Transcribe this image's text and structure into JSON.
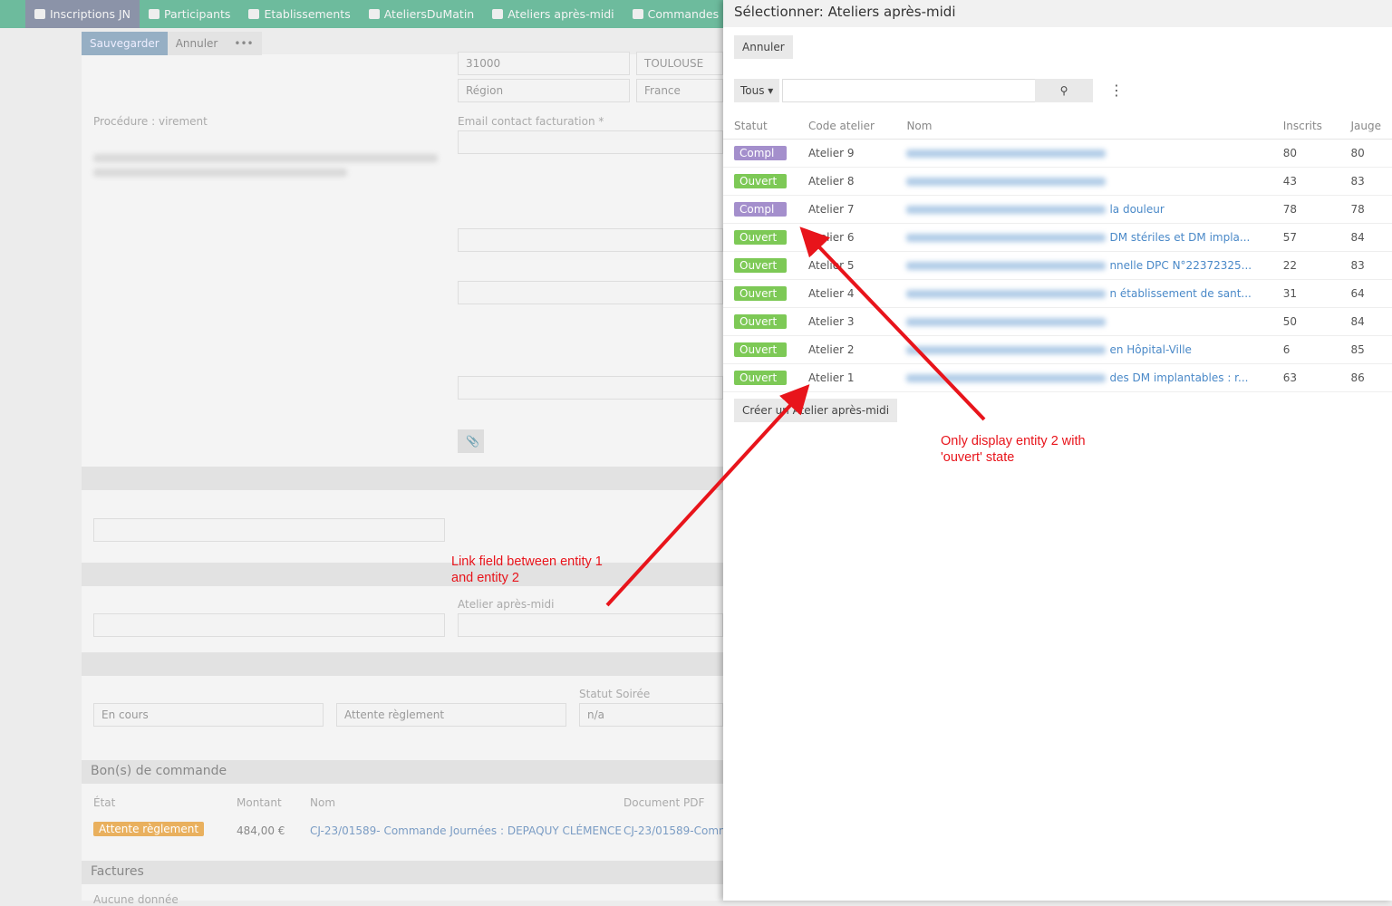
{
  "nav": {
    "tabs": [
      {
        "label": "Inscriptions JN",
        "icon": "id-card-icon",
        "active": true
      },
      {
        "label": "Participants",
        "icon": "user-check-icon"
      },
      {
        "label": "Etablissements",
        "icon": "building-icon"
      },
      {
        "label": "AteliersDuMatin",
        "icon": "presentation-icon"
      },
      {
        "label": "Ateliers après-midi",
        "icon": "presentation-icon"
      },
      {
        "label": "Commandes",
        "icon": "document-icon"
      }
    ]
  },
  "toolbar": {
    "save": "Sauvegarder",
    "cancel": "Annuler",
    "more": "•••"
  },
  "form": {
    "postal_code": "31000",
    "city": "TOULOUSE",
    "region_placeholder": "Région",
    "country": "France",
    "procedure": "Procédure : virement",
    "email_label": "Email contact facturation *",
    "atelier_label": "Atelier après-midi",
    "statut_soiree_label": "Statut Soirée",
    "statut_soiree": "n/a",
    "statut_inscription": "En cours",
    "statut_reglement": "Attente règlement"
  },
  "orders": {
    "title": "Bon(s) de commande",
    "columns": [
      "État",
      "Montant",
      "Nom",
      "Document PDF"
    ],
    "row": {
      "state": "Attente règlement",
      "amount": "484,00 €",
      "name": "CJ-23/01589- Commande Journées : DEPAQUY CLÉMENCE",
      "pdf": "CJ-23/01589-Comm"
    }
  },
  "invoices": {
    "title": "Factures",
    "empty": "Aucune donnée"
  },
  "panel": {
    "title": "Sélectionner: Ateliers après-midi",
    "cancel": "Annuler",
    "filter": "Tous ▾",
    "search_placeholder": "",
    "create": "Créer un Atelier après-midi",
    "columns": [
      "Statut",
      "Code atelier",
      "Nom",
      "Inscrits",
      "Jauge"
    ],
    "rows": [
      {
        "status": "Compl",
        "code": "Atelier 9",
        "nom": "",
        "inscrits": "80",
        "jauge": "80"
      },
      {
        "status": "Ouvert",
        "code": "Atelier 8",
        "nom": "",
        "inscrits": "43",
        "jauge": "83"
      },
      {
        "status": "Compl",
        "code": "Atelier 7",
        "nom": "la douleur",
        "inscrits": "78",
        "jauge": "78"
      },
      {
        "status": "Ouvert",
        "code": "Atelier 6",
        "nom": "DM stériles et DM impla...",
        "inscrits": "57",
        "jauge": "84"
      },
      {
        "status": "Ouvert",
        "code": "Atelier 5",
        "nom": "nnelle DPC N°22372325...",
        "inscrits": "22",
        "jauge": "83"
      },
      {
        "status": "Ouvert",
        "code": "Atelier 4",
        "nom": "n établissement de sant...",
        "inscrits": "31",
        "jauge": "64"
      },
      {
        "status": "Ouvert",
        "code": "Atelier 3",
        "nom": "",
        "inscrits": "50",
        "jauge": "84"
      },
      {
        "status": "Ouvert",
        "code": "Atelier 2",
        "nom": "en Hôpital-Ville",
        "inscrits": "6",
        "jauge": "85"
      },
      {
        "status": "Ouvert",
        "code": "Atelier 1",
        "nom": "des DM implantables : r...",
        "inscrits": "63",
        "jauge": "86"
      }
    ]
  },
  "colors": {
    "compl": "#a48fcc",
    "ouvert": "#7dc956",
    "warning": "#e9b05e",
    "nav": "#6dbb9d",
    "annotation": "#e8141b"
  },
  "annotations": {
    "link": "Link field between entity 1 and entity 2",
    "filter": "Only display entity 2 with 'ouvert' state"
  }
}
